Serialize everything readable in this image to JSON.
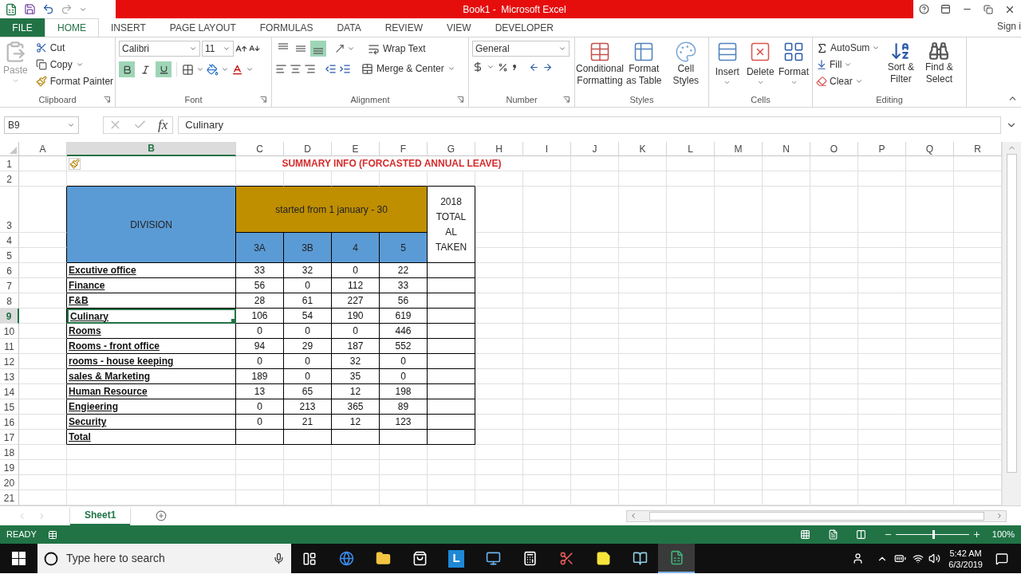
{
  "window": {
    "title": "Book1 -  Microsoft Excel"
  },
  "ribbon_tabs": [
    {
      "label": "FILE",
      "kind": "file",
      "selected": false
    },
    {
      "label": "HOME",
      "kind": "tab",
      "selected": true
    },
    {
      "label": "INSERT",
      "kind": "tab",
      "selected": false
    },
    {
      "label": "PAGE LAYOUT",
      "kind": "tab",
      "selected": false
    },
    {
      "label": "FORMULAS",
      "kind": "tab",
      "selected": false
    },
    {
      "label": "DATA",
      "kind": "tab",
      "selected": false
    },
    {
      "label": "REVIEW",
      "kind": "tab",
      "selected": false
    },
    {
      "label": "VIEW",
      "kind": "tab",
      "selected": false
    },
    {
      "label": "DEVELOPER",
      "kind": "tab",
      "selected": false
    }
  ],
  "account": {
    "label": "Sign i"
  },
  "clipboard": {
    "label": "Clipboard",
    "paste": {
      "label": "Paste",
      "disabled": true
    },
    "cut": "Cut",
    "copy": "Copy",
    "format_painter": "Format Painter"
  },
  "font": {
    "label": "Font",
    "font_name": "Calibri",
    "font_size": "11",
    "toggles": [
      {
        "kind": "bold",
        "selected": true
      },
      {
        "kind": "italic",
        "selected": false
      },
      {
        "kind": "underline",
        "selected": true
      }
    ]
  },
  "alignment": {
    "label": "Alignment",
    "vertical": [
      {
        "kind": "top",
        "selected": false
      },
      {
        "kind": "middle",
        "selected": false
      },
      {
        "kind": "bottom",
        "selected": true
      }
    ],
    "wrap_text": "Wrap Text",
    "merge_center": "Merge & Center"
  },
  "number": {
    "label": "Number",
    "format": "General"
  },
  "styles": {
    "label": "Styles",
    "buttons": [
      "Conditional Formatting",
      "Format as Table",
      "Cell Styles"
    ]
  },
  "cells": {
    "label": "Cells",
    "buttons": [
      "Insert",
      "Delete",
      "Format"
    ]
  },
  "editing": {
    "label": "Editing",
    "autosum": "AutoSum",
    "fill": "Fill",
    "clear": "Clear",
    "sort_filter": "Sort & Filter",
    "find_select": "Find & Select"
  },
  "formula_bar": {
    "name_box": "B9",
    "function_symbol": "fx",
    "value": "Culinary"
  },
  "columns": [
    {
      "label": "A",
      "selected": false
    },
    {
      "label": "B",
      "selected": true
    },
    {
      "label": "C",
      "selected": false
    },
    {
      "label": "D",
      "selected": false
    },
    {
      "label": "E",
      "selected": false
    },
    {
      "label": "F",
      "selected": false
    },
    {
      "label": "G",
      "selected": false
    },
    {
      "label": "H",
      "selected": false
    },
    {
      "label": "I",
      "selected": false
    },
    {
      "label": "J",
      "selected": false
    },
    {
      "label": "K",
      "selected": false
    },
    {
      "label": "L",
      "selected": false
    },
    {
      "label": "M",
      "selected": false
    },
    {
      "label": "N",
      "selected": false
    },
    {
      "label": "O",
      "selected": false
    },
    {
      "label": "P",
      "selected": false
    },
    {
      "label": "Q",
      "selected": false
    },
    {
      "label": "R",
      "selected": false
    }
  ],
  "row_numbers": [
    {
      "label": "1",
      "selected": false
    },
    {
      "label": "2",
      "selected": false
    },
    {
      "label": "3",
      "selected": false
    },
    {
      "label": "4",
      "selected": false
    },
    {
      "label": "5",
      "selected": false
    },
    {
      "label": "6",
      "selected": false
    },
    {
      "label": "7",
      "selected": false
    },
    {
      "label": "8",
      "selected": false
    },
    {
      "label": "9",
      "selected": true
    },
    {
      "label": "10",
      "selected": false
    },
    {
      "label": "11",
      "selected": false
    },
    {
      "label": "12",
      "selected": false
    },
    {
      "label": "13",
      "selected": false
    },
    {
      "label": "14",
      "selected": false
    },
    {
      "label": "15",
      "selected": false
    },
    {
      "label": "16",
      "selected": false
    },
    {
      "label": "17",
      "selected": false
    },
    {
      "label": "18",
      "selected": false
    },
    {
      "label": "19",
      "selected": false
    },
    {
      "label": "20",
      "selected": false
    },
    {
      "label": "21",
      "selected": false
    }
  ],
  "table": {
    "title": "SUMMARY INFO (FORCASTED ANNUAL LEAVE)",
    "division_header": "DIVISION",
    "period_header": "started from 1 january - 30",
    "sub_columns": [
      "3A",
      "3B",
      "4",
      "5"
    ],
    "total_header": "2018 TOTAL AL TAKEN",
    "rows": [
      {
        "division": "Excutive office",
        "values": [
          "33",
          "32",
          "0",
          "22"
        ],
        "selected": false
      },
      {
        "division": "Finance",
        "values": [
          "56",
          "0",
          "112",
          "33"
        ],
        "selected": false
      },
      {
        "division": "F&B",
        "values": [
          "28",
          "61",
          "227",
          "56"
        ],
        "selected": false
      },
      {
        "division": "Culinary",
        "values": [
          "106",
          "54",
          "190",
          "619"
        ],
        "selected": true
      },
      {
        "division": "Rooms",
        "values": [
          "0",
          "0",
          "0",
          "446"
        ],
        "selected": false
      },
      {
        "division": "Rooms - front office",
        "values": [
          "94",
          "29",
          "187",
          "552"
        ],
        "selected": false
      },
      {
        "division": "rooms - house keeping",
        "values": [
          "0",
          "0",
          "32",
          "0"
        ],
        "selected": false
      },
      {
        "division": "sales & Marketing",
        "values": [
          "189",
          "0",
          "35",
          "0"
        ],
        "selected": false
      },
      {
        "division": "Human Resource",
        "values": [
          "13",
          "65",
          "12",
          "198"
        ],
        "selected": false
      },
      {
        "division": "Engieering",
        "values": [
          "0",
          "213",
          "365",
          "89"
        ],
        "selected": false
      },
      {
        "division": "Security",
        "values": [
          "0",
          "21",
          "12",
          "123"
        ],
        "selected": false
      }
    ],
    "total_label": "Total"
  },
  "sheet_tabs": [
    {
      "label": "Sheet1",
      "selected": true
    }
  ],
  "status_bar": {
    "status": "READY",
    "zoom": {
      "level": 0.5,
      "reading": "100%"
    }
  },
  "taskbar": {
    "search_placeholder": "Type here to search",
    "apps": [
      {
        "kind": "task-view",
        "active": false
      },
      {
        "kind": "edge",
        "active": false
      },
      {
        "kind": "folder",
        "active": false
      },
      {
        "kind": "store",
        "active": false
      },
      {
        "kind": "letter",
        "label": "L",
        "active": false
      },
      {
        "kind": "computer",
        "active": false
      },
      {
        "kind": "calculator",
        "active": false
      },
      {
        "kind": "snipping",
        "active": false
      },
      {
        "kind": "sticky",
        "active": false
      },
      {
        "kind": "book",
        "active": false
      },
      {
        "kind": "excel",
        "active": true
      }
    ],
    "time": "5:42 AM",
    "date": "6/3/2019"
  }
}
